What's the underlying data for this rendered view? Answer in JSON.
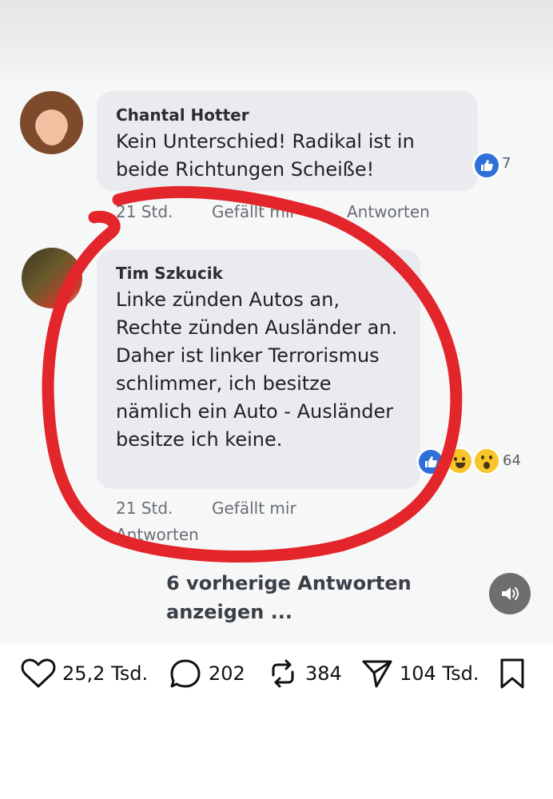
{
  "comments": [
    {
      "author": "Chantal Hotter",
      "text": "Kein Unterschied! Radikal ist in beide Richtungen Scheiße!",
      "reaction_count": "7",
      "time": "21 Std.",
      "like_label": "Gefällt mir",
      "reply_label": "Antworten"
    },
    {
      "author": "Tim Szkucik",
      "text": "Linke zünden Autos an, Rechte zünden Ausländer an. Daher ist linker Terrorismus schlimmer, ich besitze nämlich ein Auto - Ausländer besitze ich keine.",
      "reaction_count": "64",
      "time": "21 Std.",
      "like_label": "Gefällt mir",
      "reply_label": "Antworten"
    }
  ],
  "more_replies_label": "6 vorherige Antworten anzeigen ...",
  "actions": {
    "likes": "25,2 Tsd.",
    "comments": "202",
    "reposts": "384",
    "shares": "104 Tsd."
  },
  "colors": {
    "annotation_circle": "#e3262b",
    "like_blue": "#2e6fd8",
    "bubble": "#e9ebee"
  }
}
